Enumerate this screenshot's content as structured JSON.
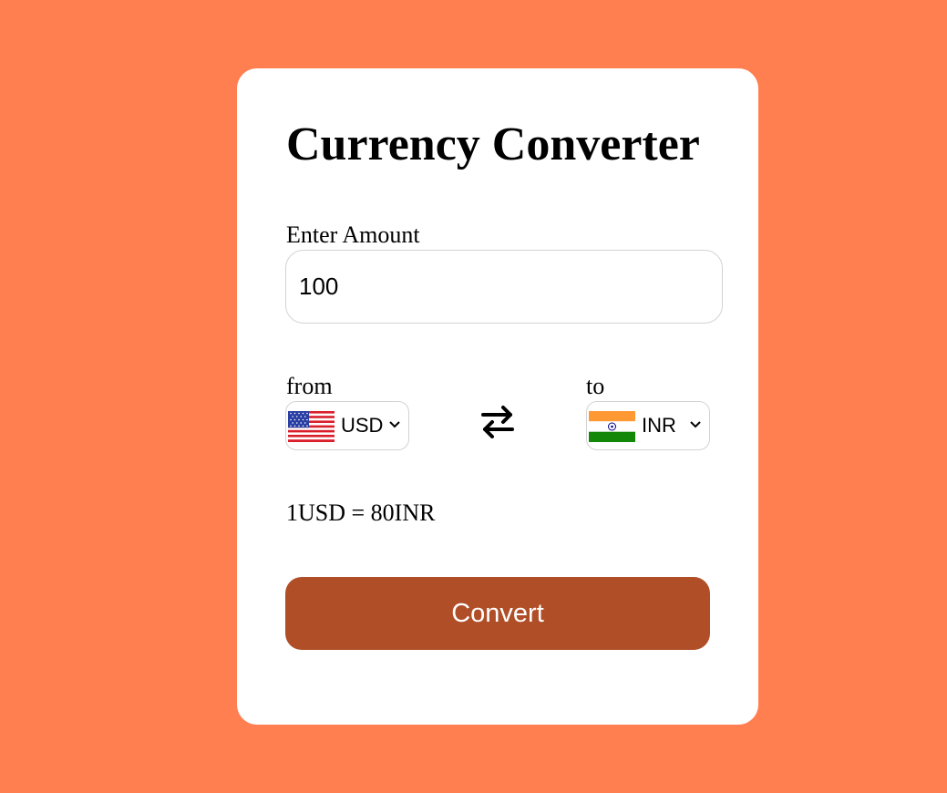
{
  "colors": {
    "page_background": "#ff7f50",
    "card_background": "#ffffff",
    "button_background": "#b04e28",
    "button_text": "#ffffff"
  },
  "converter": {
    "title": "Currency Converter",
    "amount_label": "Enter Amount",
    "amount_value": "100",
    "from_label": "from",
    "to_label": "to",
    "from_currency": {
      "code": "USD",
      "flag_icon": "us-flag-icon"
    },
    "to_currency": {
      "code": "INR",
      "flag_icon": "india-flag-icon"
    },
    "swap_icon": "swap-arrows-icon",
    "exchange_rate": "1USD = 80INR",
    "convert_label": "Convert"
  }
}
